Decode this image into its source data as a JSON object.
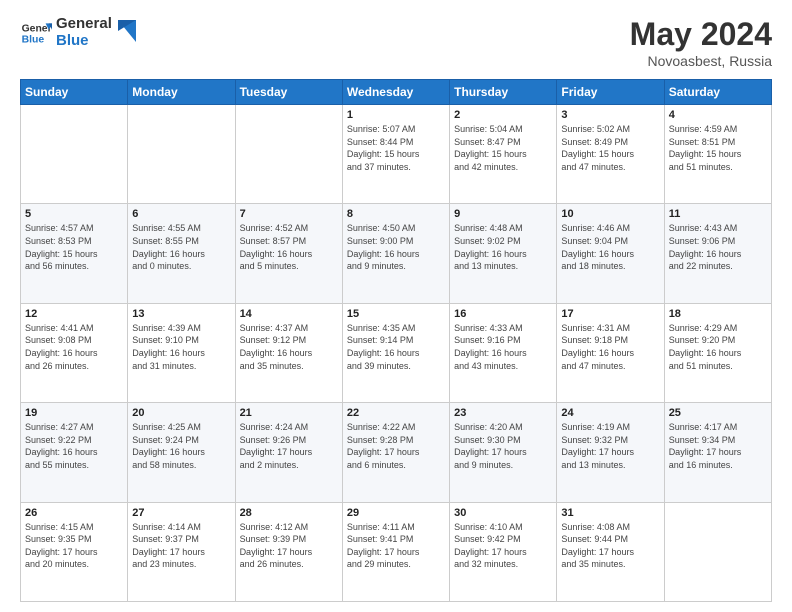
{
  "logo": {
    "line1": "General",
    "line2": "Blue"
  },
  "title": "May 2024",
  "location": "Novoasbest, Russia",
  "header_days": [
    "Sunday",
    "Monday",
    "Tuesday",
    "Wednesday",
    "Thursday",
    "Friday",
    "Saturday"
  ],
  "weeks": [
    [
      {
        "day": "",
        "info": ""
      },
      {
        "day": "",
        "info": ""
      },
      {
        "day": "",
        "info": ""
      },
      {
        "day": "1",
        "info": "Sunrise: 5:07 AM\nSunset: 8:44 PM\nDaylight: 15 hours\nand 37 minutes."
      },
      {
        "day": "2",
        "info": "Sunrise: 5:04 AM\nSunset: 8:47 PM\nDaylight: 15 hours\nand 42 minutes."
      },
      {
        "day": "3",
        "info": "Sunrise: 5:02 AM\nSunset: 8:49 PM\nDaylight: 15 hours\nand 47 minutes."
      },
      {
        "day": "4",
        "info": "Sunrise: 4:59 AM\nSunset: 8:51 PM\nDaylight: 15 hours\nand 51 minutes."
      }
    ],
    [
      {
        "day": "5",
        "info": "Sunrise: 4:57 AM\nSunset: 8:53 PM\nDaylight: 15 hours\nand 56 minutes."
      },
      {
        "day": "6",
        "info": "Sunrise: 4:55 AM\nSunset: 8:55 PM\nDaylight: 16 hours\nand 0 minutes."
      },
      {
        "day": "7",
        "info": "Sunrise: 4:52 AM\nSunset: 8:57 PM\nDaylight: 16 hours\nand 5 minutes."
      },
      {
        "day": "8",
        "info": "Sunrise: 4:50 AM\nSunset: 9:00 PM\nDaylight: 16 hours\nand 9 minutes."
      },
      {
        "day": "9",
        "info": "Sunrise: 4:48 AM\nSunset: 9:02 PM\nDaylight: 16 hours\nand 13 minutes."
      },
      {
        "day": "10",
        "info": "Sunrise: 4:46 AM\nSunset: 9:04 PM\nDaylight: 16 hours\nand 18 minutes."
      },
      {
        "day": "11",
        "info": "Sunrise: 4:43 AM\nSunset: 9:06 PM\nDaylight: 16 hours\nand 22 minutes."
      }
    ],
    [
      {
        "day": "12",
        "info": "Sunrise: 4:41 AM\nSunset: 9:08 PM\nDaylight: 16 hours\nand 26 minutes."
      },
      {
        "day": "13",
        "info": "Sunrise: 4:39 AM\nSunset: 9:10 PM\nDaylight: 16 hours\nand 31 minutes."
      },
      {
        "day": "14",
        "info": "Sunrise: 4:37 AM\nSunset: 9:12 PM\nDaylight: 16 hours\nand 35 minutes."
      },
      {
        "day": "15",
        "info": "Sunrise: 4:35 AM\nSunset: 9:14 PM\nDaylight: 16 hours\nand 39 minutes."
      },
      {
        "day": "16",
        "info": "Sunrise: 4:33 AM\nSunset: 9:16 PM\nDaylight: 16 hours\nand 43 minutes."
      },
      {
        "day": "17",
        "info": "Sunrise: 4:31 AM\nSunset: 9:18 PM\nDaylight: 16 hours\nand 47 minutes."
      },
      {
        "day": "18",
        "info": "Sunrise: 4:29 AM\nSunset: 9:20 PM\nDaylight: 16 hours\nand 51 minutes."
      }
    ],
    [
      {
        "day": "19",
        "info": "Sunrise: 4:27 AM\nSunset: 9:22 PM\nDaylight: 16 hours\nand 55 minutes."
      },
      {
        "day": "20",
        "info": "Sunrise: 4:25 AM\nSunset: 9:24 PM\nDaylight: 16 hours\nand 58 minutes."
      },
      {
        "day": "21",
        "info": "Sunrise: 4:24 AM\nSunset: 9:26 PM\nDaylight: 17 hours\nand 2 minutes."
      },
      {
        "day": "22",
        "info": "Sunrise: 4:22 AM\nSunset: 9:28 PM\nDaylight: 17 hours\nand 6 minutes."
      },
      {
        "day": "23",
        "info": "Sunrise: 4:20 AM\nSunset: 9:30 PM\nDaylight: 17 hours\nand 9 minutes."
      },
      {
        "day": "24",
        "info": "Sunrise: 4:19 AM\nSunset: 9:32 PM\nDaylight: 17 hours\nand 13 minutes."
      },
      {
        "day": "25",
        "info": "Sunrise: 4:17 AM\nSunset: 9:34 PM\nDaylight: 17 hours\nand 16 minutes."
      }
    ],
    [
      {
        "day": "26",
        "info": "Sunrise: 4:15 AM\nSunset: 9:35 PM\nDaylight: 17 hours\nand 20 minutes."
      },
      {
        "day": "27",
        "info": "Sunrise: 4:14 AM\nSunset: 9:37 PM\nDaylight: 17 hours\nand 23 minutes."
      },
      {
        "day": "28",
        "info": "Sunrise: 4:12 AM\nSunset: 9:39 PM\nDaylight: 17 hours\nand 26 minutes."
      },
      {
        "day": "29",
        "info": "Sunrise: 4:11 AM\nSunset: 9:41 PM\nDaylight: 17 hours\nand 29 minutes."
      },
      {
        "day": "30",
        "info": "Sunrise: 4:10 AM\nSunset: 9:42 PM\nDaylight: 17 hours\nand 32 minutes."
      },
      {
        "day": "31",
        "info": "Sunrise: 4:08 AM\nSunset: 9:44 PM\nDaylight: 17 hours\nand 35 minutes."
      },
      {
        "day": "",
        "info": ""
      }
    ]
  ]
}
